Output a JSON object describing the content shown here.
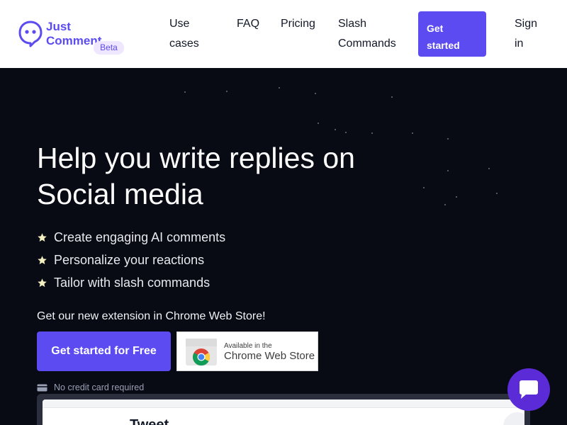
{
  "brand": {
    "line1": "Just",
    "line2": "Comment",
    "badge": "Beta"
  },
  "nav": {
    "use_cases": "Use cases",
    "faq": "FAQ",
    "pricing": "Pricing",
    "slash_commands": "Slash Commands",
    "get_started": "Get started",
    "sign_in": "Sign in"
  },
  "hero": {
    "title": "Help you write replies on Social media",
    "features": [
      "Create engaging AI comments",
      "Personalize your reactions",
      "Tailor with slash commands"
    ],
    "extension_note": "Get our new extension in Chrome Web Store!",
    "cta": "Get started for Free",
    "chrome_badge": {
      "line1": "Available in the",
      "line2": "Chrome Web Store"
    },
    "no_card": "No credit card required"
  },
  "preview": {
    "title": "Tweet"
  },
  "colors": {
    "accent": "#5b4bf0",
    "background": "#080a14",
    "chat": "#5b2bd8"
  },
  "icons": [
    "chat-logo-icon",
    "star-icon",
    "credit-card-icon",
    "chrome-icon",
    "back-arrow-icon",
    "chat-icon"
  ]
}
